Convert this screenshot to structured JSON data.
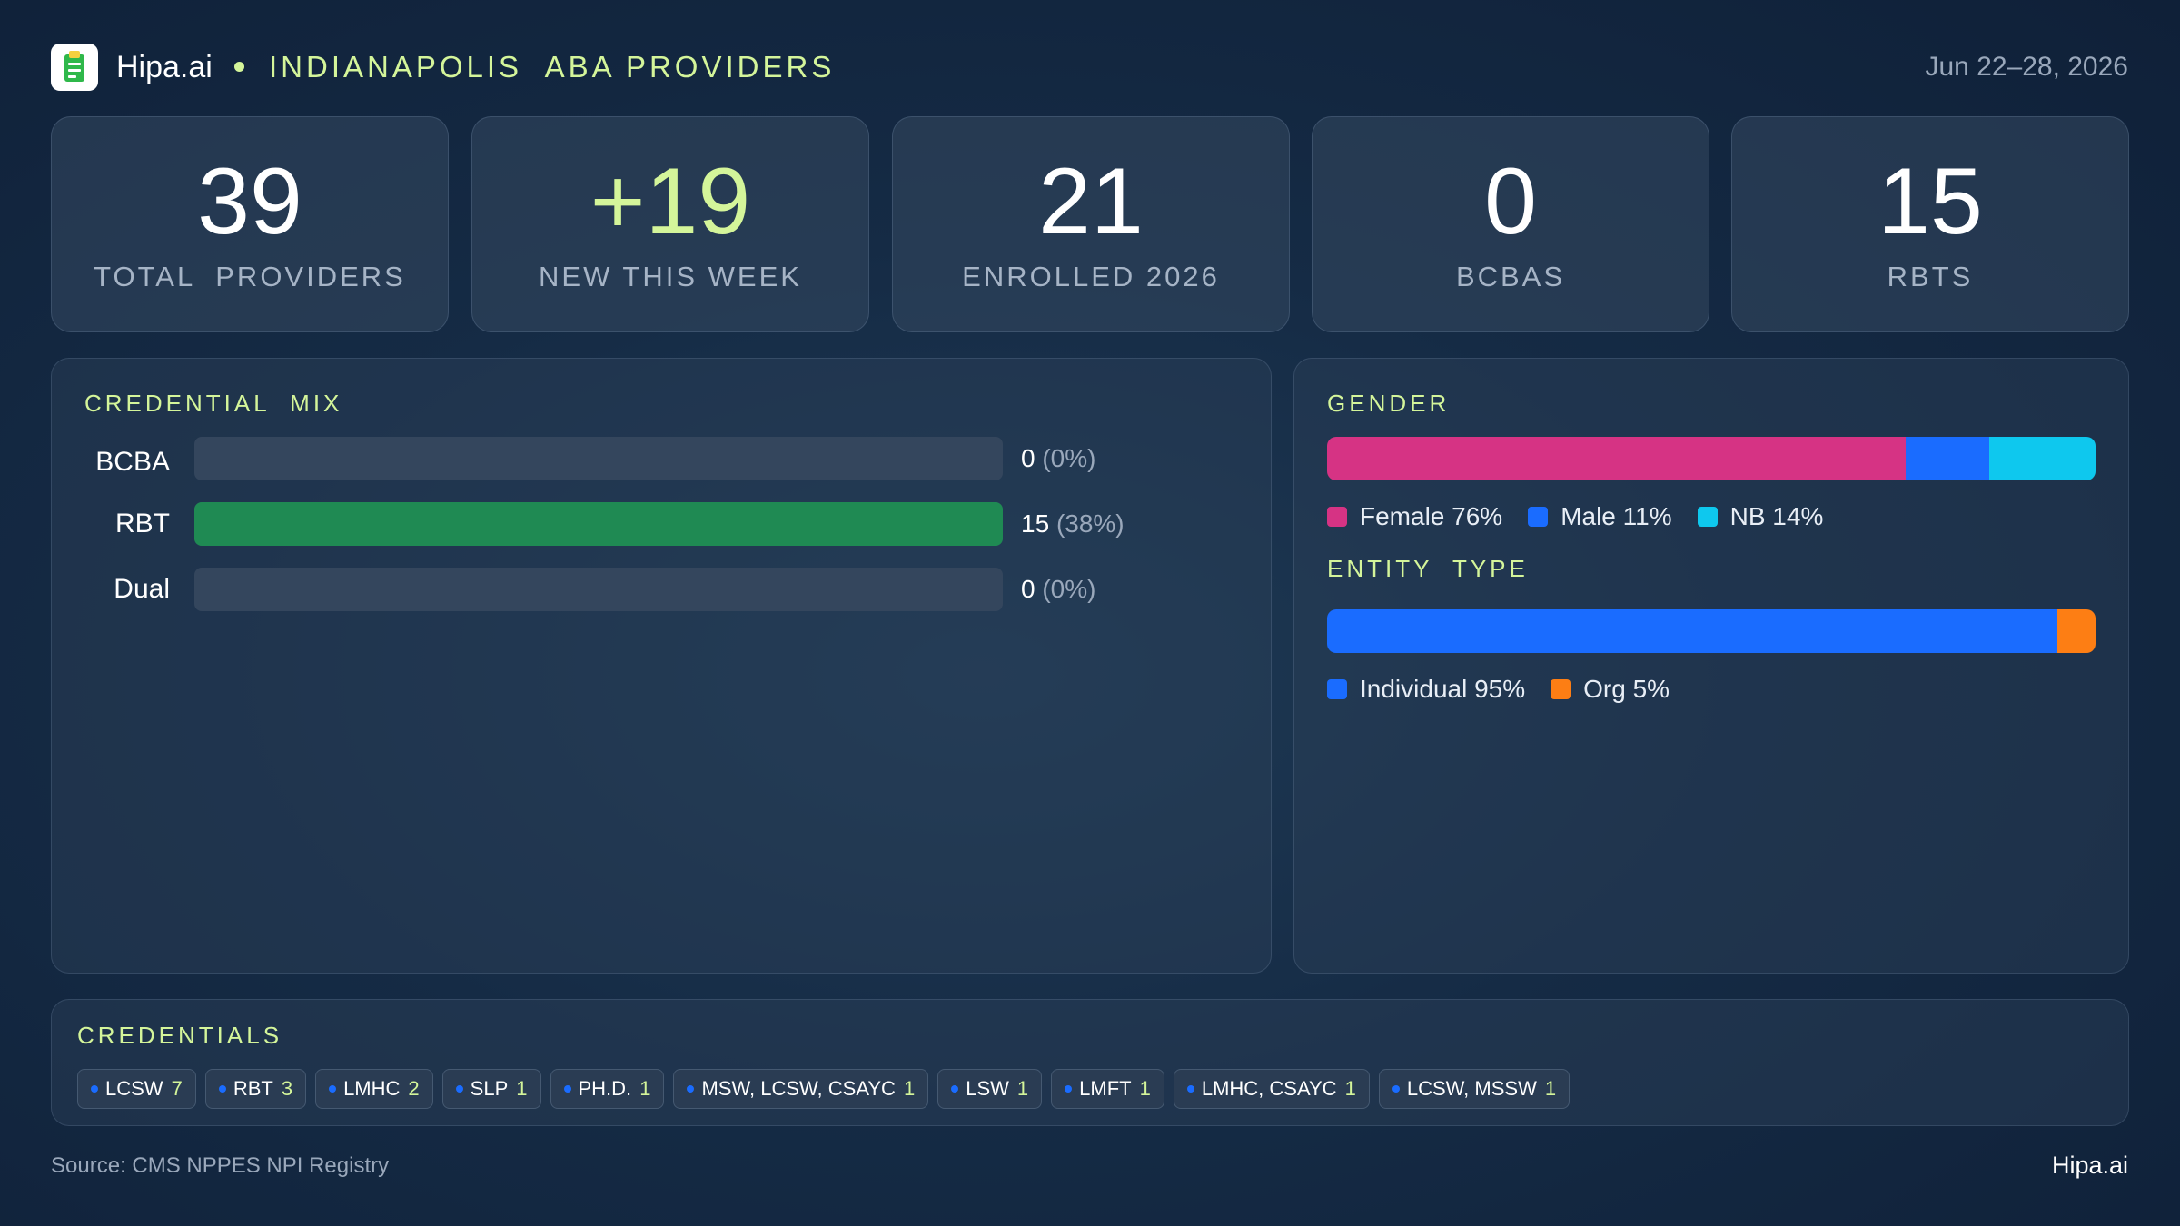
{
  "header": {
    "brand": "Hipa.ai",
    "title": "INDIANAPOLIS  ABA PROVIDERS",
    "date_range": "Jun 22–28, 2026",
    "logo_icon": "clipboard-icon"
  },
  "stats": [
    {
      "value": "39",
      "label": "TOTAL  PROVIDERS"
    },
    {
      "value": "+19",
      "label": "NEW THIS WEEK"
    },
    {
      "value": "21",
      "label": "ENROLLED 2026"
    },
    {
      "value": "0",
      "label": "BCBAS"
    },
    {
      "value": "15",
      "label": "RBTS"
    }
  ],
  "credential_mix": {
    "title": "CREDENTIAL  MIX",
    "rows": [
      {
        "label": "BCBA",
        "count": "0",
        "pct": "(0%)"
      },
      {
        "label": "RBT",
        "count": "15",
        "pct": "(38%)"
      },
      {
        "label": "Dual",
        "count": "0",
        "pct": "(0%)"
      }
    ],
    "bar_color": "#1f8a53"
  },
  "chart_data": [
    {
      "type": "bar",
      "title": "CREDENTIAL  MIX",
      "categories": [
        "BCBA",
        "RBT",
        "Dual"
      ],
      "values": [
        0,
        15,
        0
      ],
      "percents": [
        0,
        38,
        0
      ],
      "max": 15
    },
    {
      "type": "bar",
      "title": "GENDER",
      "stacked": true,
      "series": [
        {
          "name": "Female",
          "value": 76,
          "color": "#d63384"
        },
        {
          "name": "Male",
          "value": 11,
          "color": "#1a6cff"
        },
        {
          "name": "NB",
          "value": 14,
          "color": "#0ec8ee"
        }
      ]
    },
    {
      "type": "bar",
      "title": "ENTITY TYPE",
      "stacked": true,
      "series": [
        {
          "name": "Individual",
          "value": 95,
          "color": "#1a6cff"
        },
        {
          "name": "Org",
          "value": 5,
          "color": "#fd7e14"
        }
      ]
    }
  ],
  "gender": {
    "title": "GENDER",
    "legend": [
      {
        "label": "Female 76%",
        "color": "#d63384"
      },
      {
        "label": "Male 11%",
        "color": "#1a6cff"
      },
      {
        "label": "NB 14%",
        "color": "#0ec8ee"
      }
    ]
  },
  "entity": {
    "title": "ENTITY  TYPE",
    "legend": [
      {
        "label": "Individual 95%",
        "color": "#1a6cff"
      },
      {
        "label": "Org 5%",
        "color": "#fd7e14"
      }
    ]
  },
  "credentials": {
    "title": "CREDENTIALS",
    "chips": [
      {
        "label": "LCSW",
        "count": "7"
      },
      {
        "label": "RBT",
        "count": "3"
      },
      {
        "label": "LMHC",
        "count": "2"
      },
      {
        "label": "SLP",
        "count": "1"
      },
      {
        "label": "PH.D.",
        "count": "1"
      },
      {
        "label": "MSW, LCSW, CSAYC",
        "count": "1"
      },
      {
        "label": "LSW",
        "count": "1"
      },
      {
        "label": "LMFT",
        "count": "1"
      },
      {
        "label": "LMHC, CSAYC",
        "count": "1"
      },
      {
        "label": "LCSW, MSSW",
        "count": "1"
      }
    ]
  },
  "footer": {
    "source": "Source: CMS NPPES NPI Registry",
    "brand": "Hipa.ai"
  }
}
